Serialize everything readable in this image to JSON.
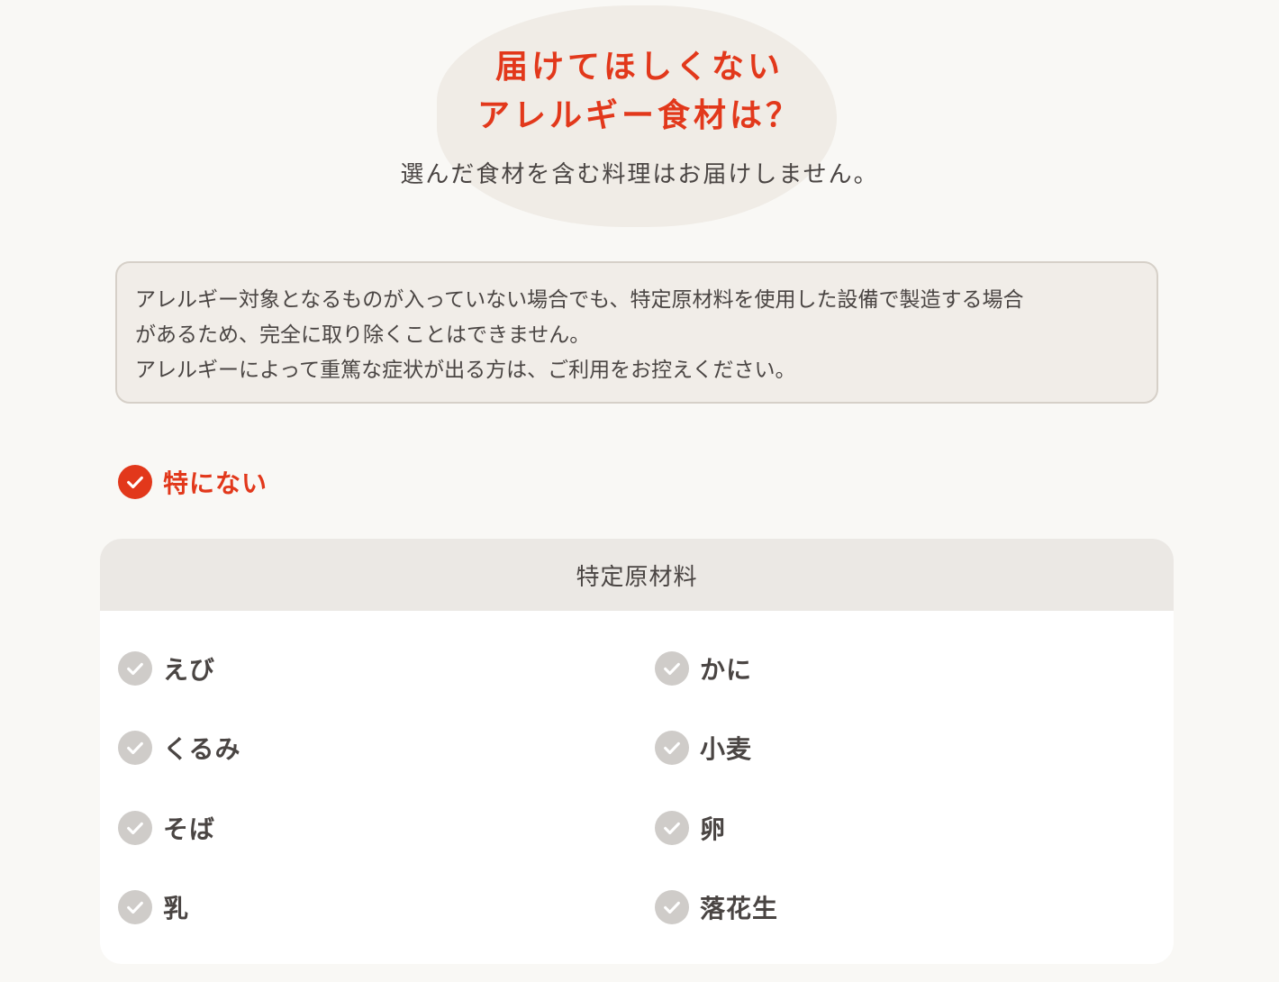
{
  "heading": {
    "line1": "届けてほしくない",
    "line2": "アレルギー食材は？"
  },
  "subtitle": "選んだ食材を含む料理はお届けしません。",
  "notice": {
    "line1": "アレルギー対象となるものが入っていない場合でも、特定原材料を使用した設備で製造する場合",
    "line2": "があるため、完全に取り除くことはできません。",
    "line3": "アレルギーによって重篤な症状が出る方は、ご利用をお控えください。"
  },
  "none_option": {
    "label": "特にない",
    "checked": true
  },
  "panel": {
    "title": "特定原材料",
    "items": [
      {
        "label": "えび",
        "checked": false
      },
      {
        "label": "かに",
        "checked": false
      },
      {
        "label": "くるみ",
        "checked": false
      },
      {
        "label": "小麦",
        "checked": false
      },
      {
        "label": "そば",
        "checked": false
      },
      {
        "label": "卵",
        "checked": false
      },
      {
        "label": "乳",
        "checked": false
      },
      {
        "label": "落花生",
        "checked": false
      }
    ]
  },
  "icons": {
    "check": "check-circle-icon"
  },
  "colors": {
    "accent": "#e2381b",
    "text": "#4a4543",
    "inactive_check": "#cfccc9",
    "background": "#f9f8f5"
  }
}
